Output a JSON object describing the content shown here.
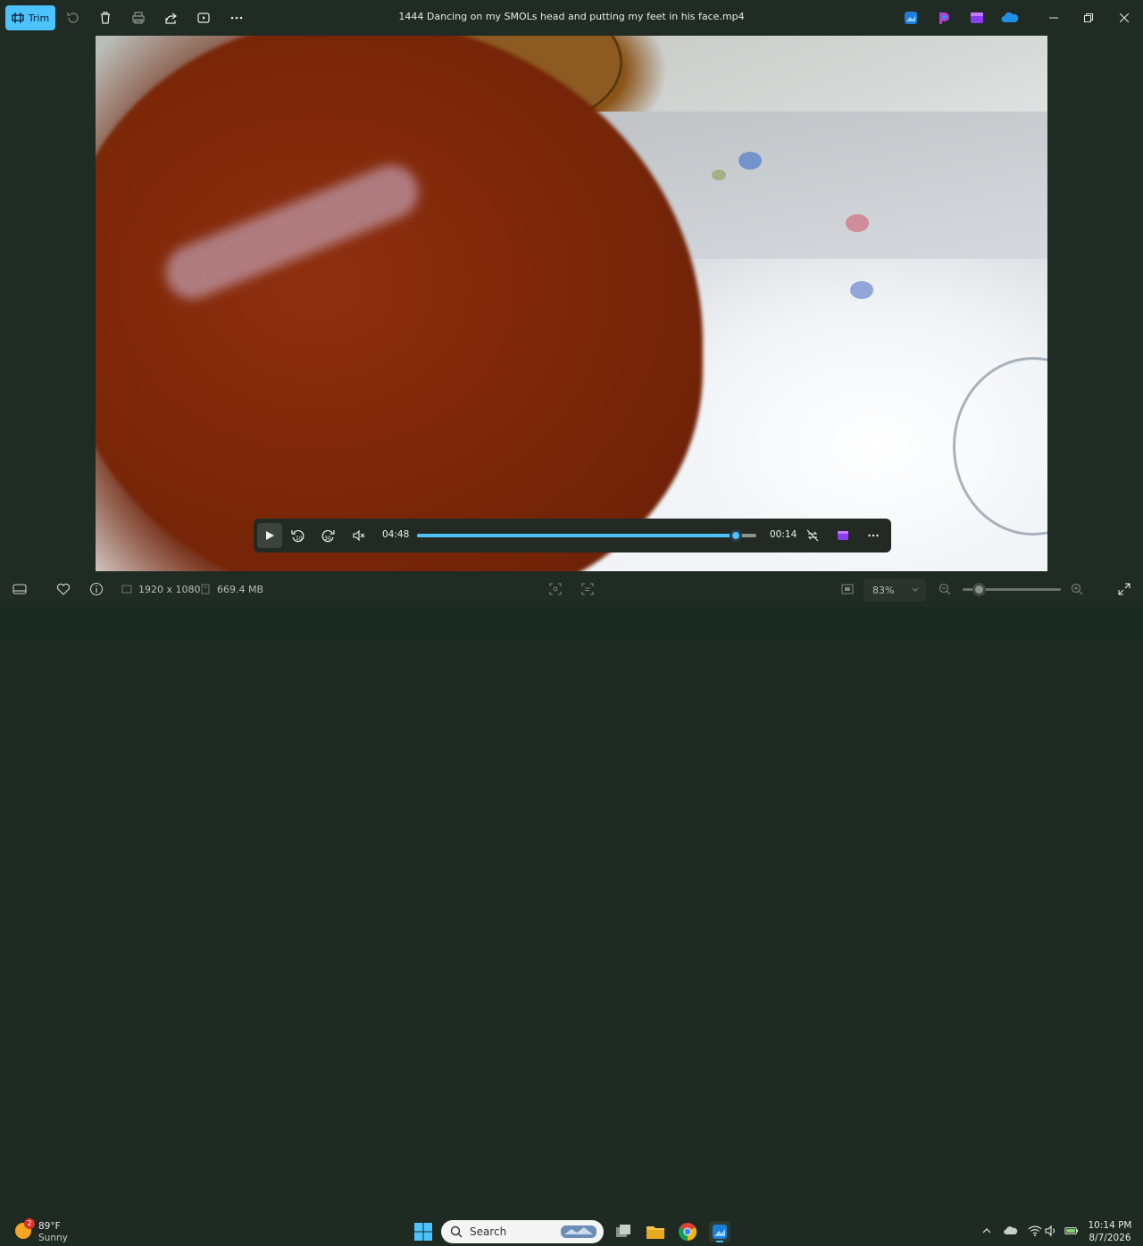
{
  "toolbar": {
    "trim_label": "Trim",
    "icons": [
      "rotate-icon",
      "delete-icon",
      "print-icon",
      "share-icon",
      "slideshow-icon",
      "more-icon"
    ]
  },
  "window": {
    "title": "1444 Dancing on my SMOLs head and putting my feet in his face.mp4"
  },
  "player": {
    "elapsed": "04:48",
    "remaining": "00:14",
    "progress_fraction": 0.94,
    "progress_color": "#4cc2ff"
  },
  "status": {
    "dimensions": "1920 x 1080",
    "file_size": "669.4 MB",
    "zoom_level": "83%",
    "zoom_slider_fraction": 0.16
  },
  "taskbar": {
    "weather_temp": "89°F",
    "weather_desc": "Sunny",
    "weather_badge": "2",
    "search_placeholder": "Search",
    "time": "10:14 PM",
    "date": "8/7/2026"
  },
  "colors": {
    "accent": "#4cc2ff",
    "app_bg": "#202b23",
    "taskbar_bg": "#1b2a22"
  }
}
